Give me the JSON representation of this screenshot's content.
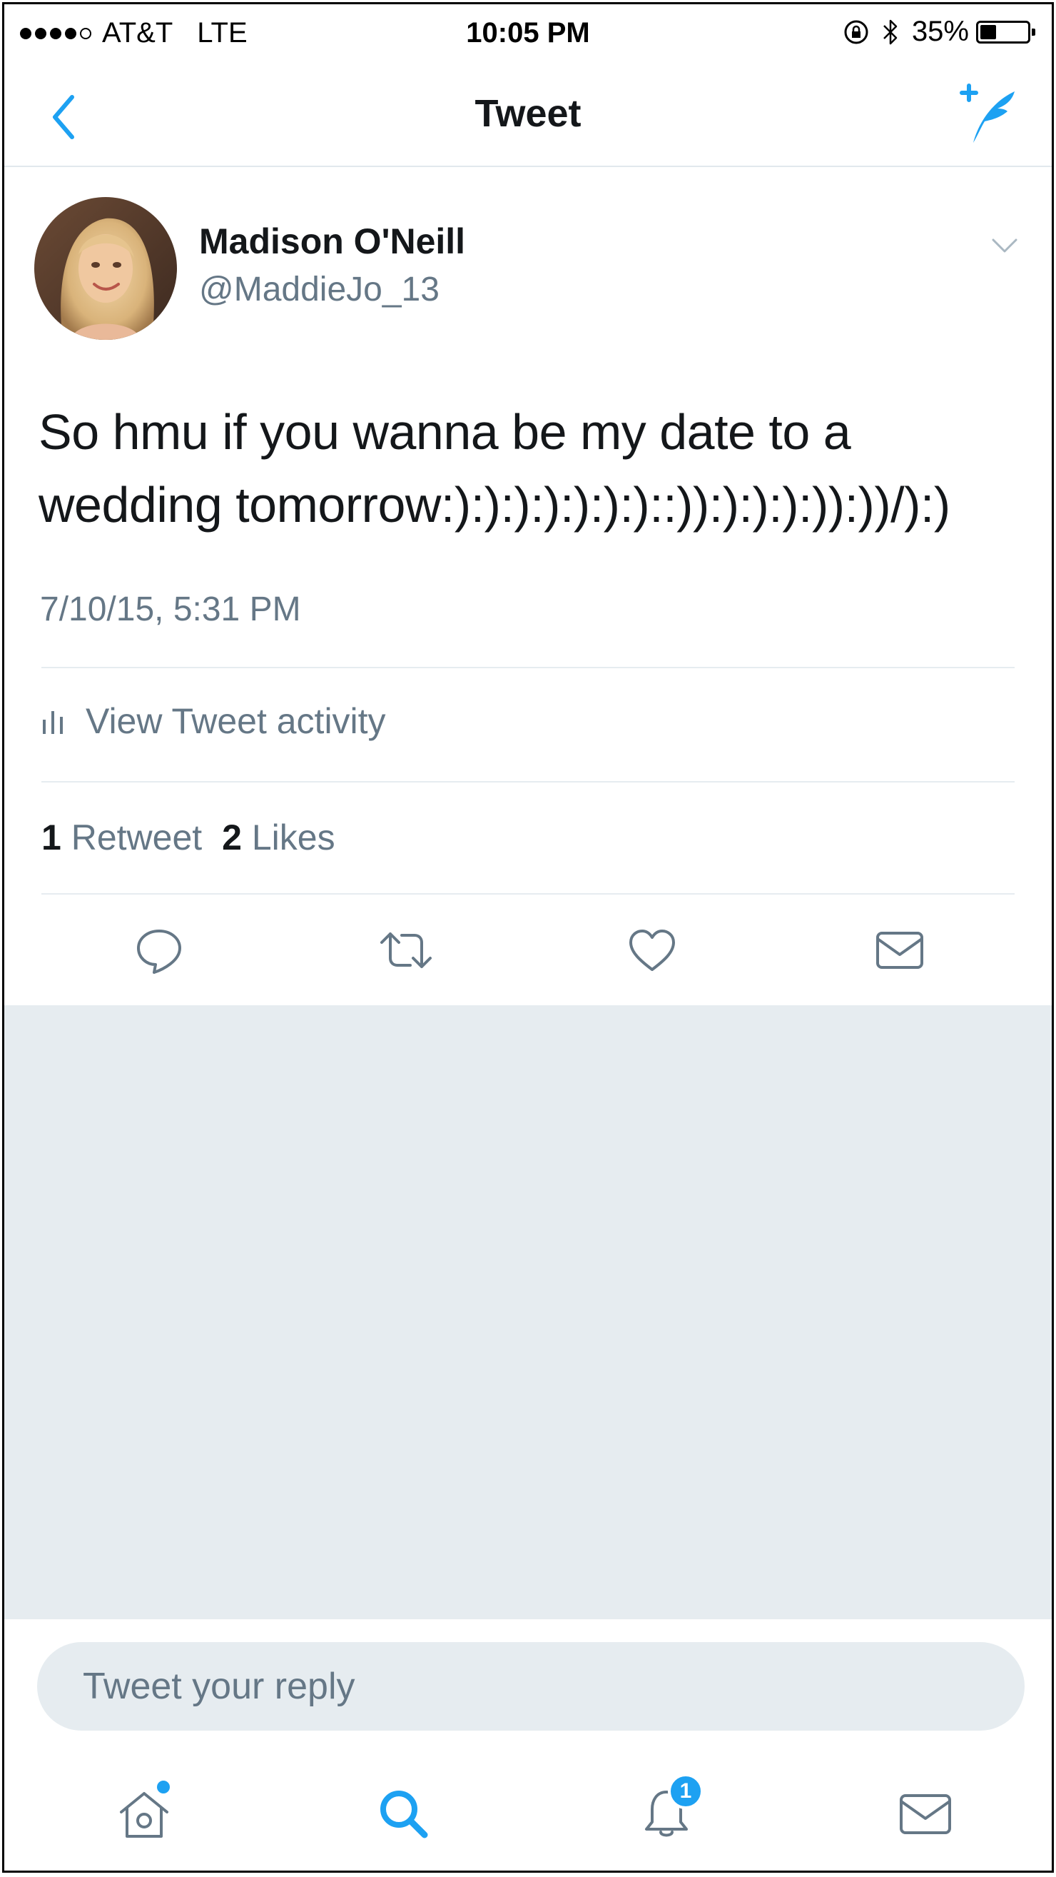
{
  "status_bar": {
    "carrier": "AT&T",
    "network": "LTE",
    "time": "10:05 PM",
    "battery": "35%",
    "battery_level": 0.35,
    "signal_bars_filled": 4,
    "signal_bars_total": 5,
    "icons": [
      "orientation-lock-icon",
      "bluetooth-icon",
      "battery-icon"
    ]
  },
  "nav": {
    "title": "Tweet",
    "back_icon": "chevron-left-icon",
    "compose_icon": "compose-feather-icon"
  },
  "tweet": {
    "display_name": "Madison O'Neill",
    "handle": "@MaddieJo_13",
    "text_line1": "So hmu if you wanna be my date to a",
    "text_line2": "wedding tomorrow:):):):):):):)::)):):):):)):))/):)",
    "timestamp": "7/10/15, 5:31 PM",
    "activity_label": "View Tweet activity",
    "retweet_count": "1",
    "retweet_label": "Retweet",
    "like_count": "2",
    "like_label": "Likes",
    "actions": [
      "reply-icon",
      "retweet-icon",
      "like-icon",
      "direct-message-icon"
    ]
  },
  "reply": {
    "placeholder": "Tweet your reply"
  },
  "tabbar": {
    "tabs": [
      "home-icon",
      "search-icon",
      "notifications-icon",
      "messages-icon"
    ],
    "notifications_badge": "1"
  },
  "colors": {
    "accent": "#1da1f2",
    "text": "#14171a",
    "secondary_text": "#657786",
    "background_gray": "#e6ecf0"
  }
}
